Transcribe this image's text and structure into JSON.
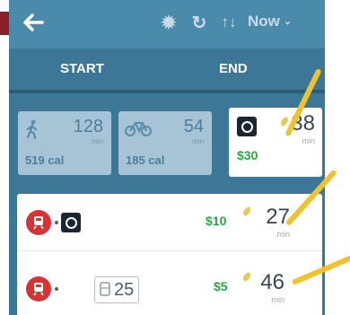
{
  "header": {
    "back_icon": "arrow-left-icon",
    "settings_icon": "gear-icon",
    "refresh_icon": "refresh-icon",
    "sort_icon": "sort-arrows-icon",
    "time_label": "Now"
  },
  "tabs": [
    {
      "label": "START"
    },
    {
      "label": "END"
    }
  ],
  "options": [
    {
      "mode": "walk",
      "minutes": "128",
      "unit": "min",
      "calories": "519 cal"
    },
    {
      "mode": "bike",
      "minutes": "54",
      "unit": "min",
      "calories": "185 cal"
    },
    {
      "mode": "uber",
      "minutes": "38",
      "unit": "min",
      "price": "$30"
    }
  ],
  "routes": [
    {
      "modes": [
        "train",
        "uber"
      ],
      "price": "$10",
      "minutes": "27",
      "unit": "min"
    },
    {
      "modes": [
        "train",
        "bus"
      ],
      "bus_number": "25",
      "price": "$5",
      "minutes": "46",
      "unit": "min"
    }
  ],
  "colors": {
    "header": "#4a8bab",
    "background": "#3d7797",
    "price": "#27a842",
    "callout": "#f2c12e",
    "train": "#d73336"
  }
}
